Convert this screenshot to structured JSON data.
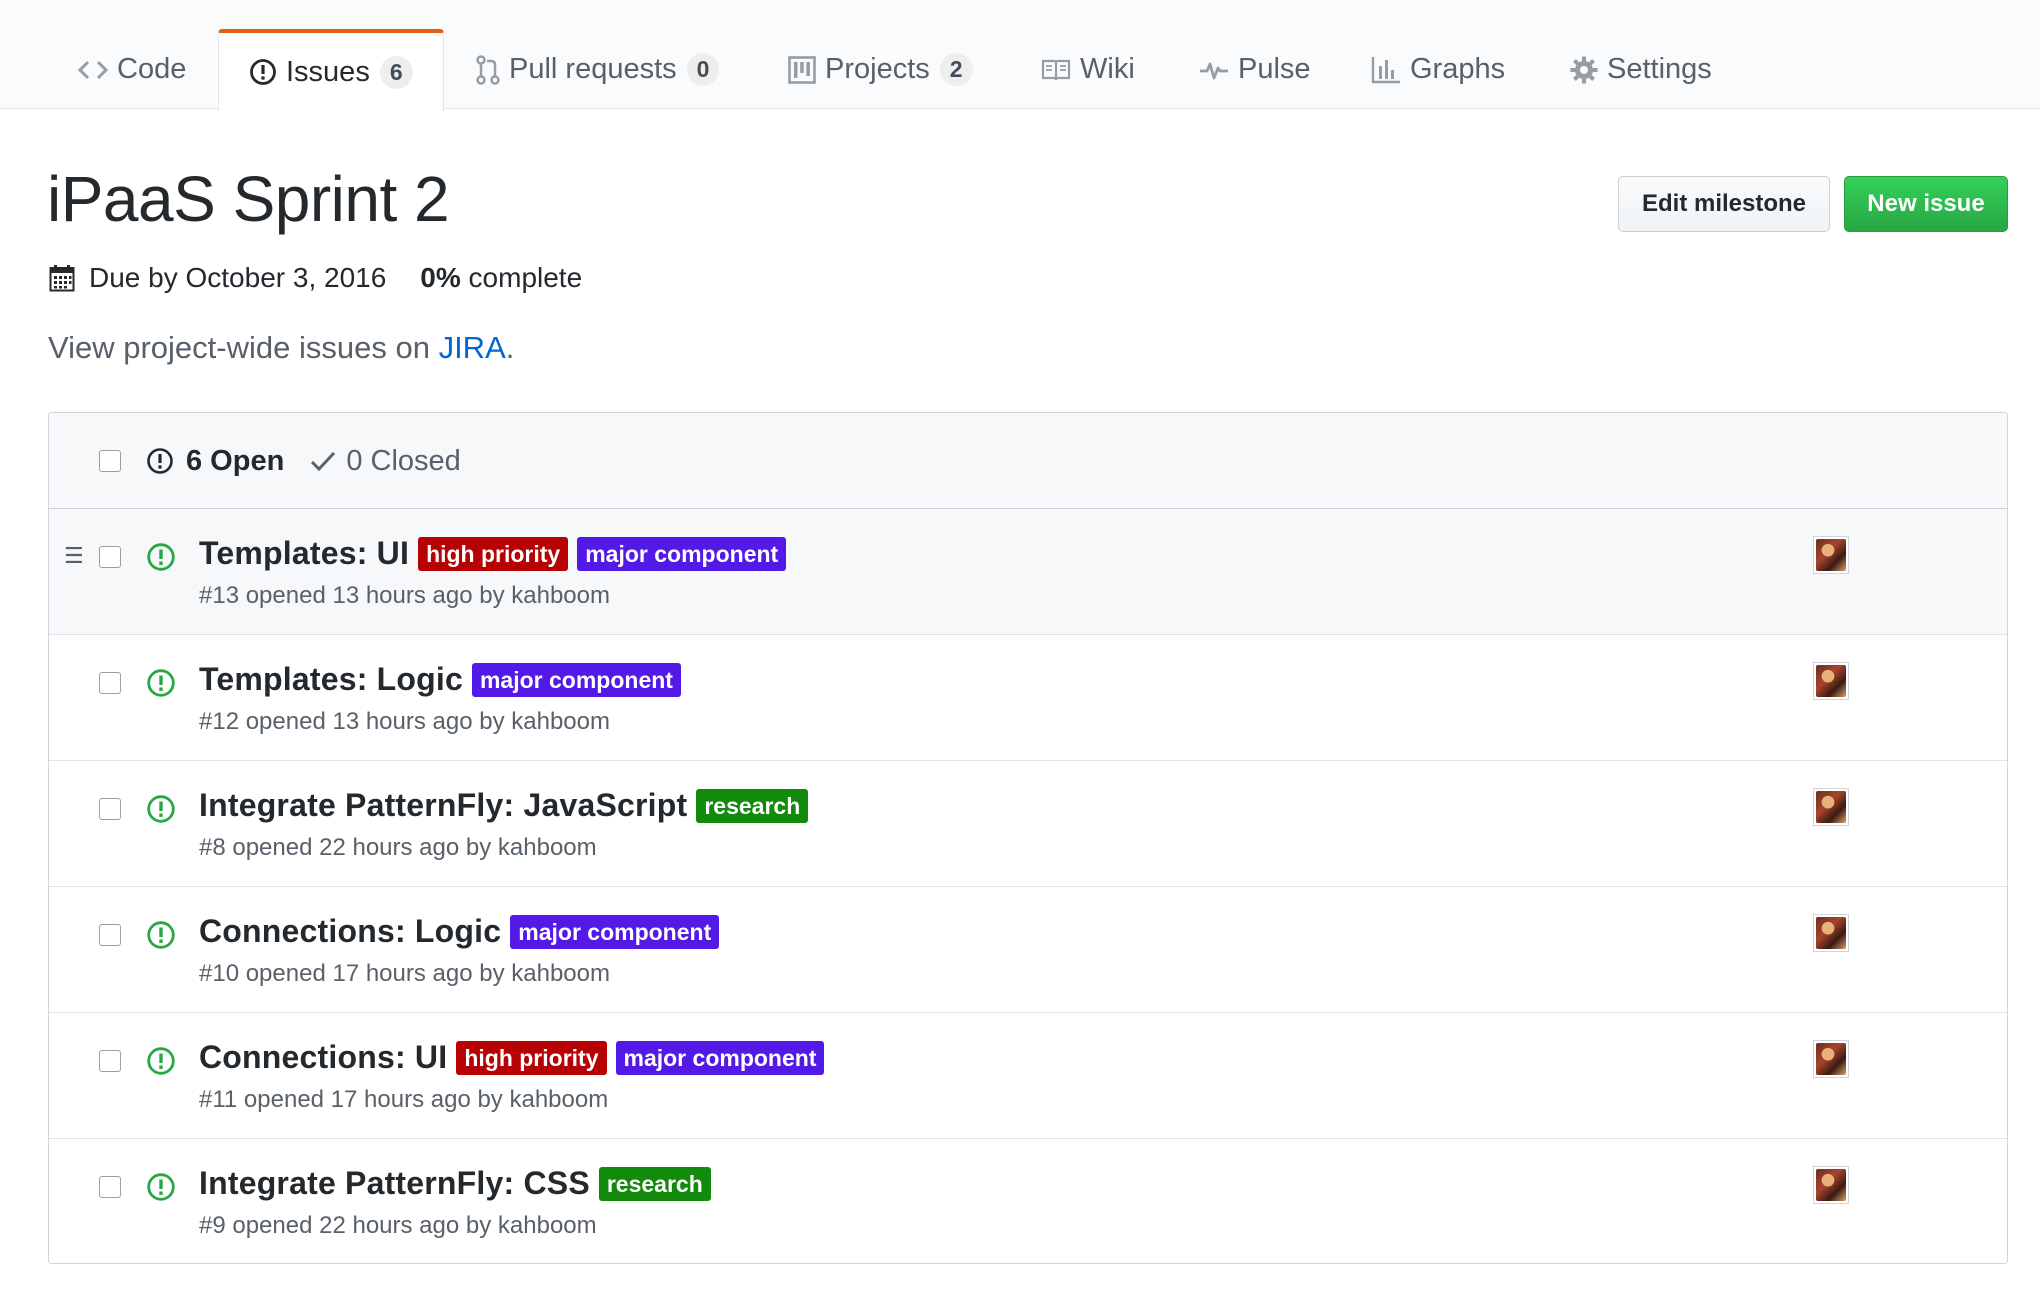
{
  "tabs": [
    {
      "label": "Code",
      "icon": "code-icon",
      "counter": null,
      "selected": false
    },
    {
      "label": "Issues",
      "icon": "issue-opened-icon",
      "counter": "6",
      "selected": true
    },
    {
      "label": "Pull requests",
      "icon": "git-pull-request-icon",
      "counter": "0",
      "selected": false
    },
    {
      "label": "Projects",
      "icon": "project-icon",
      "counter": "2",
      "selected": false
    },
    {
      "label": "Wiki",
      "icon": "book-icon",
      "counter": null,
      "selected": false
    },
    {
      "label": "Pulse",
      "icon": "pulse-icon",
      "counter": null,
      "selected": false
    },
    {
      "label": "Graphs",
      "icon": "graph-icon",
      "counter": null,
      "selected": false
    },
    {
      "label": "Settings",
      "icon": "gear-icon",
      "counter": null,
      "selected": false
    }
  ],
  "milestone": {
    "title": "iPaaS Sprint 2",
    "due": "Due by October 3, 2016",
    "percent": "0%",
    "percent_suffix": "complete",
    "description_prefix": "View project-wide issues on ",
    "description_link": "JIRA",
    "description_suffix": "."
  },
  "buttons": {
    "edit_milestone": "Edit milestone",
    "new_issue": "New issue"
  },
  "states": {
    "open": "6 Open",
    "closed": "0 Closed"
  },
  "issues": [
    {
      "title": "Templates: UI",
      "labels": [
        {
          "text": "high priority",
          "kind": "high"
        },
        {
          "text": "major component",
          "kind": "major"
        }
      ],
      "meta": "#13 opened 13 hours ago by kahboom"
    },
    {
      "title": "Templates: Logic",
      "labels": [
        {
          "text": "major component",
          "kind": "major"
        }
      ],
      "meta": "#12 opened 13 hours ago by kahboom"
    },
    {
      "title": "Integrate PatternFly: JavaScript",
      "labels": [
        {
          "text": "research",
          "kind": "research"
        }
      ],
      "meta": "#8 opened 22 hours ago by kahboom"
    },
    {
      "title": "Connections: Logic",
      "labels": [
        {
          "text": "major component",
          "kind": "major"
        }
      ],
      "meta": "#10 opened 17 hours ago by kahboom"
    },
    {
      "title": "Connections: UI",
      "labels": [
        {
          "text": "high priority",
          "kind": "high"
        },
        {
          "text": "major component",
          "kind": "major"
        }
      ],
      "meta": "#11 opened 17 hours ago by kahboom"
    },
    {
      "title": "Integrate PatternFly: CSS",
      "labels": [
        {
          "text": "research",
          "kind": "research"
        }
      ],
      "meta": "#9 opened 22 hours ago by kahboom"
    }
  ],
  "colors": {
    "accent_tab": "#e36209",
    "open_issue": "#28a745",
    "label_high_priority": "#b60205",
    "label_major_component": "#5319e7",
    "label_research": "#128a0c",
    "link": "#0366d6"
  }
}
